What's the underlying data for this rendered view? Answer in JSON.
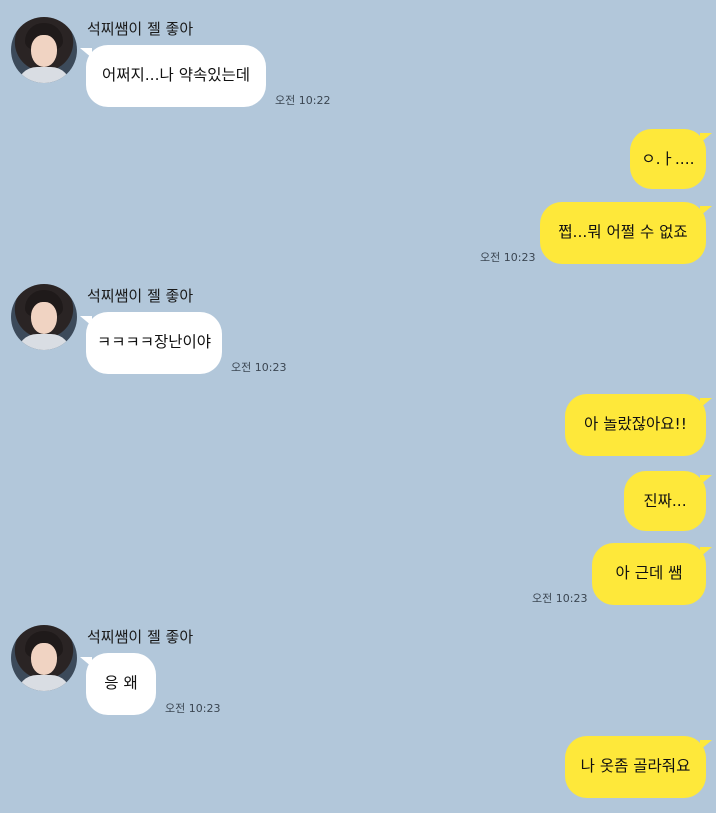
{
  "sender": {
    "name": "석찌쌤이 젤 좋아"
  },
  "messages": [
    {
      "from": "them",
      "text": "어쩌지...나 약속있는데",
      "time": "오전 10:22"
    },
    {
      "from": "me",
      "text": "ㅇ.ㅏ...."
    },
    {
      "from": "me",
      "text": "쩝...뭐 어쩔 수 없죠",
      "time": "오전 10:23"
    },
    {
      "from": "them",
      "text": "ㅋㅋㅋㅋ장난이야",
      "time": "오전 10:23"
    },
    {
      "from": "me",
      "text": "아 놀랐잖아요!!"
    },
    {
      "from": "me",
      "text": "진짜..."
    },
    {
      "from": "me",
      "text": "아 근데 쌤",
      "time": "오전 10:23"
    },
    {
      "from": "them",
      "text": "응 왜",
      "time": "오전 10:23"
    },
    {
      "from": "me",
      "text": "나 옷좀 골라줘요"
    }
  ],
  "colors": {
    "background": "#b2c7da",
    "incoming": "#ffffff",
    "outgoing": "#fee83a"
  }
}
